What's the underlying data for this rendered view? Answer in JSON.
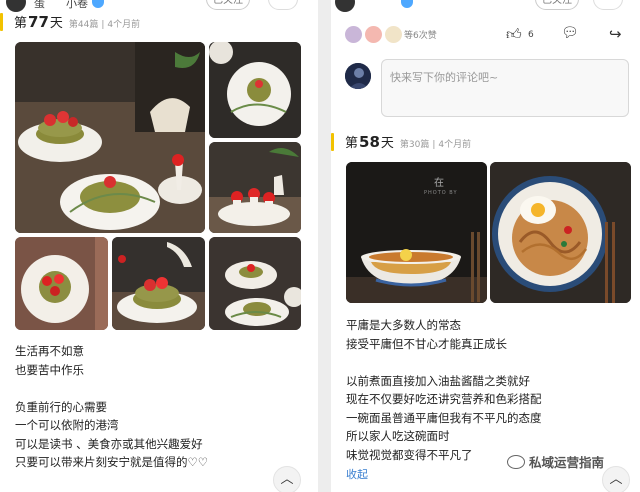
{
  "left_post": {
    "user_name": "蛋",
    "user_name2": "小卷",
    "badge": "",
    "follow_label": "已关注",
    "day_prefix": "第",
    "day_number": "77",
    "day_suffix": "天",
    "post_count": "第44篇",
    "time_ago": "4个月前",
    "text_lines": [
      "生活再不如意",
      "也要苦中作乐",
      "",
      "负重前行的心需要",
      "一个可以依附的港湾",
      "可以是读书 、美食亦或其他兴趣爱好",
      "只要可以带来片刻安宁就是值得的♡♡"
    ],
    "expand_icon": "chevron-up-icon"
  },
  "right_post": {
    "follow_label": "已关注",
    "likes_text": "等6次赞",
    "like_count": "6",
    "comment_placeholder": "快来写下你的评论吧~",
    "day_prefix": "第",
    "day_number": "58",
    "day_suffix": "天",
    "post_count": "第30篇",
    "time_ago": "4个月前",
    "photo_caption_1": "在",
    "photo_caption_2": "PHOTO BY",
    "text_lines": [
      "平庸是大多数人的常态",
      "接受平庸但不甘心才能真正成长",
      "",
      "以前煮面直接加入油盐酱醋之类就好",
      "现在不仅要好吃还讲究营养和色彩搭配",
      "一碗面虽普通平庸但我有不平凡的态度",
      "所以家人吃这碗面时",
      "味觉视觉都变得不平凡了"
    ],
    "collapse_label": "收起",
    "expand_icon": "chevron-up-icon"
  },
  "watermark": "私域运营指南",
  "colors": {
    "accent_bar": "#f2c200",
    "link_blue": "#3a7fd0",
    "badge_blue": "#4ea8ff"
  }
}
